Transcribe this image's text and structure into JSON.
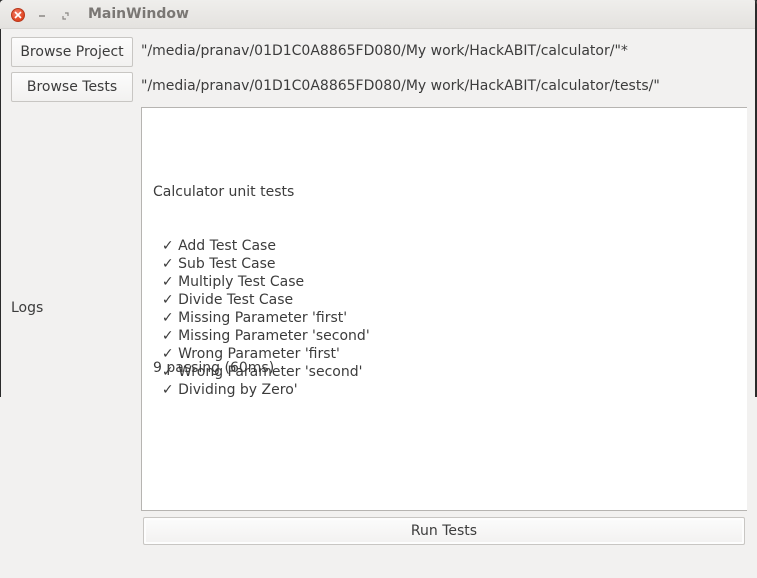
{
  "window": {
    "title": "MainWindow"
  },
  "toolbar": {
    "browse_project_label": "Browse Project",
    "browse_tests_label": "Browse Tests",
    "project_path": "\"/media/pranav/01D1C0A8865FD080/My work/HackABIT/calculator/\"*",
    "tests_path": "\"/media/pranav/01D1C0A8865FD080/My work/HackABIT/calculator/tests/\""
  },
  "logs": {
    "label": "Logs",
    "suite_title": "Calculator unit tests",
    "check_glyph": "✓",
    "items": [
      "Add Test Case",
      "Sub Test Case",
      "Multiply Test Case",
      "Divide Test Case",
      "Missing Parameter 'first'",
      "Missing Parameter 'second'",
      "Wrong Parameter 'first'",
      "Wrong Parameter 'second'",
      "Dividing by Zero'"
    ],
    "summary": "9 passing (60ms)"
  },
  "actions": {
    "run_tests_label": "Run Tests"
  },
  "colors": {
    "close_button": "#e0431f",
    "window_bg": "#f2f1f0",
    "text": "#3c3c3c"
  }
}
